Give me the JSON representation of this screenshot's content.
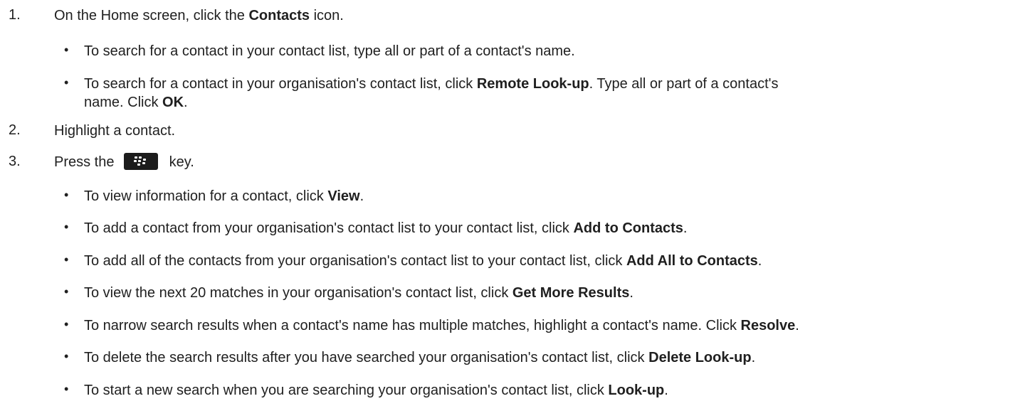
{
  "steps": [
    {
      "number": "1.",
      "parts": [
        {
          "t": "On the Home screen, click the "
        },
        {
          "t": "Contacts",
          "b": true
        },
        {
          "t": " icon."
        }
      ]
    },
    {
      "number": "2.",
      "parts": [
        {
          "t": "Highlight a contact."
        }
      ]
    },
    {
      "number": "3.",
      "parts": [
        {
          "t": "Press the "
        },
        {
          "t": " key."
        }
      ]
    }
  ],
  "step1_bullets": [
    {
      "lines": [
        [
          {
            "t": "To search for a contact in your contact list, type all or part of a contact's name."
          }
        ]
      ]
    },
    {
      "lines": [
        [
          {
            "t": "To search for a contact in your organisation's contact list, click "
          },
          {
            "t": "Remote Look-up",
            "b": true
          },
          {
            "t": ". Type all or part of a contact's"
          }
        ],
        [
          {
            "t": "name. Click "
          },
          {
            "t": "OK",
            "b": true
          },
          {
            "t": "."
          }
        ]
      ]
    }
  ],
  "step3_bullets": [
    {
      "lines": [
        [
          {
            "t": "To view information for a contact, click "
          },
          {
            "t": "View",
            "b": true
          },
          {
            "t": "."
          }
        ]
      ]
    },
    {
      "lines": [
        [
          {
            "t": "To add a contact from your organisation's contact list to your contact list, click "
          },
          {
            "t": "Add to Contacts",
            "b": true
          },
          {
            "t": "."
          }
        ]
      ]
    },
    {
      "lines": [
        [
          {
            "t": "To add all of the contacts from your organisation's contact list to your contact list, click "
          },
          {
            "t": "Add All to Contacts",
            "b": true
          },
          {
            "t": "."
          }
        ]
      ]
    },
    {
      "lines": [
        [
          {
            "t": "To view the next 20 matches in your organisation's contact list, click "
          },
          {
            "t": "Get More Results",
            "b": true
          },
          {
            "t": "."
          }
        ]
      ]
    },
    {
      "lines": [
        [
          {
            "t": "To narrow search results when a contact's name has multiple matches, highlight a contact's name. Click "
          },
          {
            "t": "Resolve",
            "b": true
          },
          {
            "t": "."
          }
        ]
      ]
    },
    {
      "lines": [
        [
          {
            "t": "To delete the search results after you have searched your organisation's contact list, click "
          },
          {
            "t": "Delete Look-up",
            "b": true
          },
          {
            "t": "."
          }
        ]
      ]
    },
    {
      "lines": [
        [
          {
            "t": "To start a new search when you are searching your organisation's contact list, click "
          },
          {
            "t": "Look-up",
            "b": true
          },
          {
            "t": "."
          }
        ]
      ]
    }
  ],
  "bullet_char": "•",
  "key_icon": "blackberry-menu-key-icon"
}
